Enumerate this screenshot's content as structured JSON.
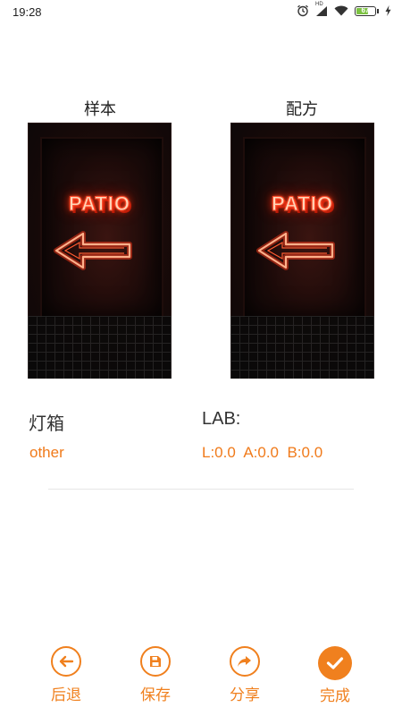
{
  "status_bar": {
    "time": "19:28",
    "network_label": "HD",
    "battery_level": "67",
    "battery_color": "#7cc242"
  },
  "samples": {
    "left_label": "样本",
    "right_label": "配方",
    "left_image": {
      "sign_text": "PATIO",
      "icon": "arrow-left-icon"
    },
    "right_image": {
      "sign_text": "PATIO",
      "icon": "arrow-left-icon"
    }
  },
  "info": {
    "category_label": "灯箱",
    "category_value": "other",
    "lab_label": "LAB:",
    "lab_value": "L:0.0  A:0.0  B:0.0"
  },
  "actions": [
    {
      "label": "后退",
      "icon": "back-arrow-icon"
    },
    {
      "label": "保存",
      "icon": "save-icon"
    },
    {
      "label": "分享",
      "icon": "share-icon"
    },
    {
      "label": "完成",
      "icon": "check-icon"
    }
  ],
  "colors": {
    "accent": "#f0801e",
    "value_text": "#f07a1a"
  }
}
